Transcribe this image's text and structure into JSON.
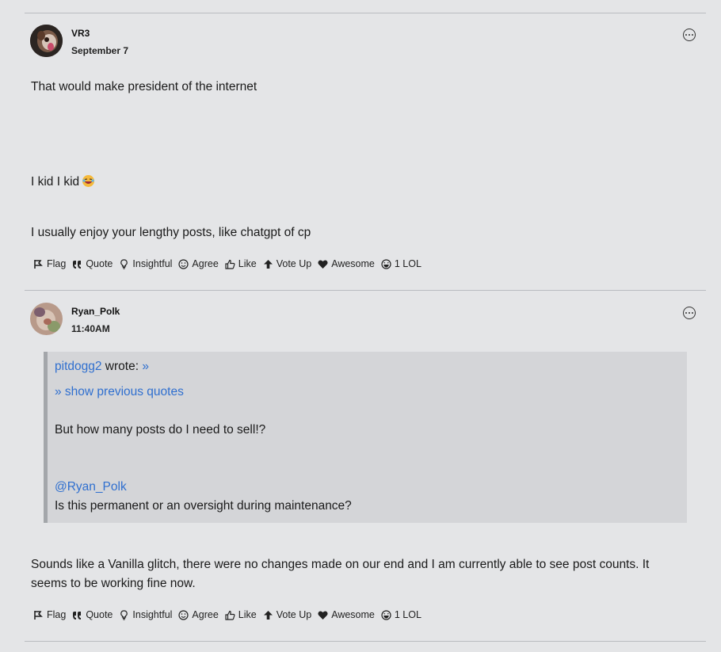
{
  "posts": [
    {
      "username": "VR3",
      "date": "September 7",
      "lines": [
        "That would make president of the internet",
        "I kid I kid",
        "I usually enjoy your lengthy posts, like chatgpt of cp"
      ],
      "emoji_icon": "laughing-emoji-icon",
      "actions": [
        "Flag",
        "Quote",
        "Insightful",
        "Agree",
        "Like",
        "Vote Up",
        "Awesome",
        "1 LOL"
      ]
    },
    {
      "username": "Ryan_Polk",
      "date": "11:40AM",
      "quote": {
        "author": "pitdogg2",
        "wrote": "wrote:",
        "jump": "»",
        "show_previous": "» show previous quotes",
        "text": "But how many posts do I need to sell!?",
        "mention": "@Ryan_Polk",
        "text2": "Is this permanent or an oversight during maintenance?"
      },
      "lines": [
        "Sounds like a Vanilla glitch, there were no changes made on our end and I am currently able to see post counts. It",
        "seems to be working fine now."
      ],
      "actions": [
        "Flag",
        "Quote",
        "Insightful",
        "Agree",
        "Like",
        "Vote Up",
        "Awesome",
        "1 LOL"
      ]
    }
  ],
  "colors": {
    "background": "#e4e5e7",
    "link": "#2f6fcf",
    "quote_bg": "#d4d5d8"
  }
}
